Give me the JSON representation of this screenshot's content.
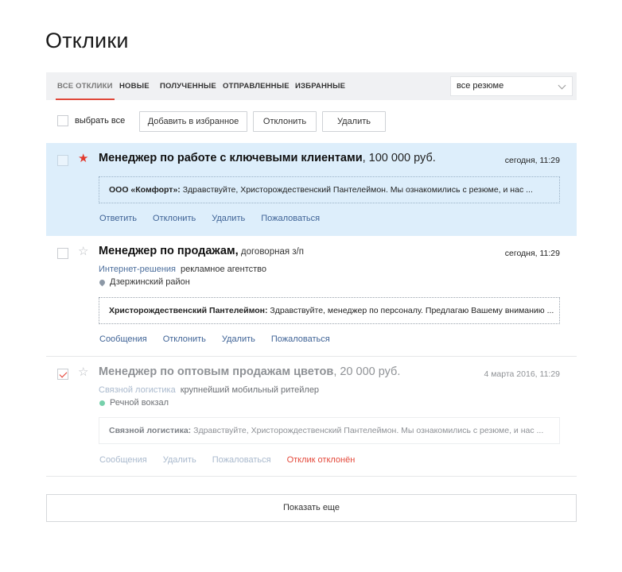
{
  "page": {
    "title": "Отклики"
  },
  "tabs": [
    {
      "label": "ВСЕ ОТКЛИКИ",
      "active": true
    },
    {
      "label": "НОВЫЕ",
      "active": false
    },
    {
      "label": "ПОЛУЧЕННЫЕ",
      "active": false
    },
    {
      "label": "ОТПРАВЛЕННЫЕ",
      "active": false
    },
    {
      "label": "ИЗБРАННЫЕ",
      "active": false
    }
  ],
  "resume_filter": {
    "selected": "все резюме"
  },
  "toolbar": {
    "select_all_label": "выбрать все",
    "add_favorite_label": "Добавить в избранное",
    "reject_label": "Отклонить",
    "delete_label": "Удалить"
  },
  "responses": [
    {
      "job_title": "Менеджер по работе с ключевыми клиентами",
      "salary": ", 100 000 руб.",
      "date": "сегодня, 11:29",
      "starred": true,
      "checked": false,
      "message_sender": "ООО «Комфорт»:",
      "message_text": " Здравствуйте, Христорождественский Пантелеймон. Мы ознакомились с резюме, и нас ...",
      "actions": [
        "Ответить",
        "Отклонить",
        "Удалить",
        "Пожаловаться"
      ]
    },
    {
      "job_title": "Менеджер по продажам,",
      "salary": " договорная з/п",
      "date": "сегодня, 11:29",
      "starred": false,
      "checked": false,
      "company_name": "Интернет-решения",
      "company_desc": "рекламное агентство",
      "location": "Дзержинский район",
      "location_icon": "map-pin-icon",
      "message_sender": "Христорождественский Пантелеймон:",
      "message_text": " Здравствуйте, менеджер по персоналу. Предлагаю Вашему вниманию ...",
      "actions": [
        "Сообщения",
        "Отклонить",
        "Удалить",
        "Пожаловаться"
      ]
    },
    {
      "job_title": "Менеджер по оптовым продажам цветов",
      "salary": ", 20 000 руб.",
      "date": "4 марта 2016, 11:29",
      "starred": false,
      "checked": true,
      "company_name": "Связной логистика",
      "company_desc": "крупнейший мобильный ритейлер",
      "location": "Речной вокзал",
      "location_icon": "metro-dot-icon",
      "message_sender": "Связной логистика:",
      "message_text": " Здравствуйте, Христорождественский Пантелеймон. Мы ознакомились с резюме, и нас ...",
      "actions": [
        "Сообщения",
        "Удалить",
        "Пожаловаться"
      ],
      "status": "Отклик отклонён"
    }
  ],
  "show_more_label": "Показать еще",
  "colors": {
    "accent_red": "#e23a2e",
    "highlight_bg": "#ddeefb",
    "link_blue": "#3f6396",
    "metro_green": "#76d0ab"
  }
}
